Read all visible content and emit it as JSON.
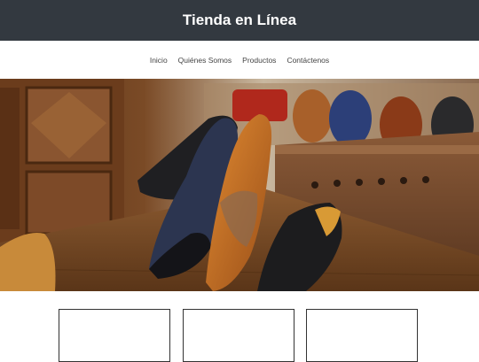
{
  "header": {
    "title": "Tienda en Línea"
  },
  "nav": {
    "items": [
      {
        "label": "Inicio"
      },
      {
        "label": "Quiénes Somos"
      },
      {
        "label": "Productos"
      },
      {
        "label": "Contáctenos"
      }
    ]
  },
  "hero": {
    "image": "shoes-display-photo"
  },
  "cards": [
    {},
    {},
    {}
  ],
  "colors": {
    "header_bg": "#333940",
    "header_text": "#ffffff",
    "nav_text": "#444444"
  }
}
